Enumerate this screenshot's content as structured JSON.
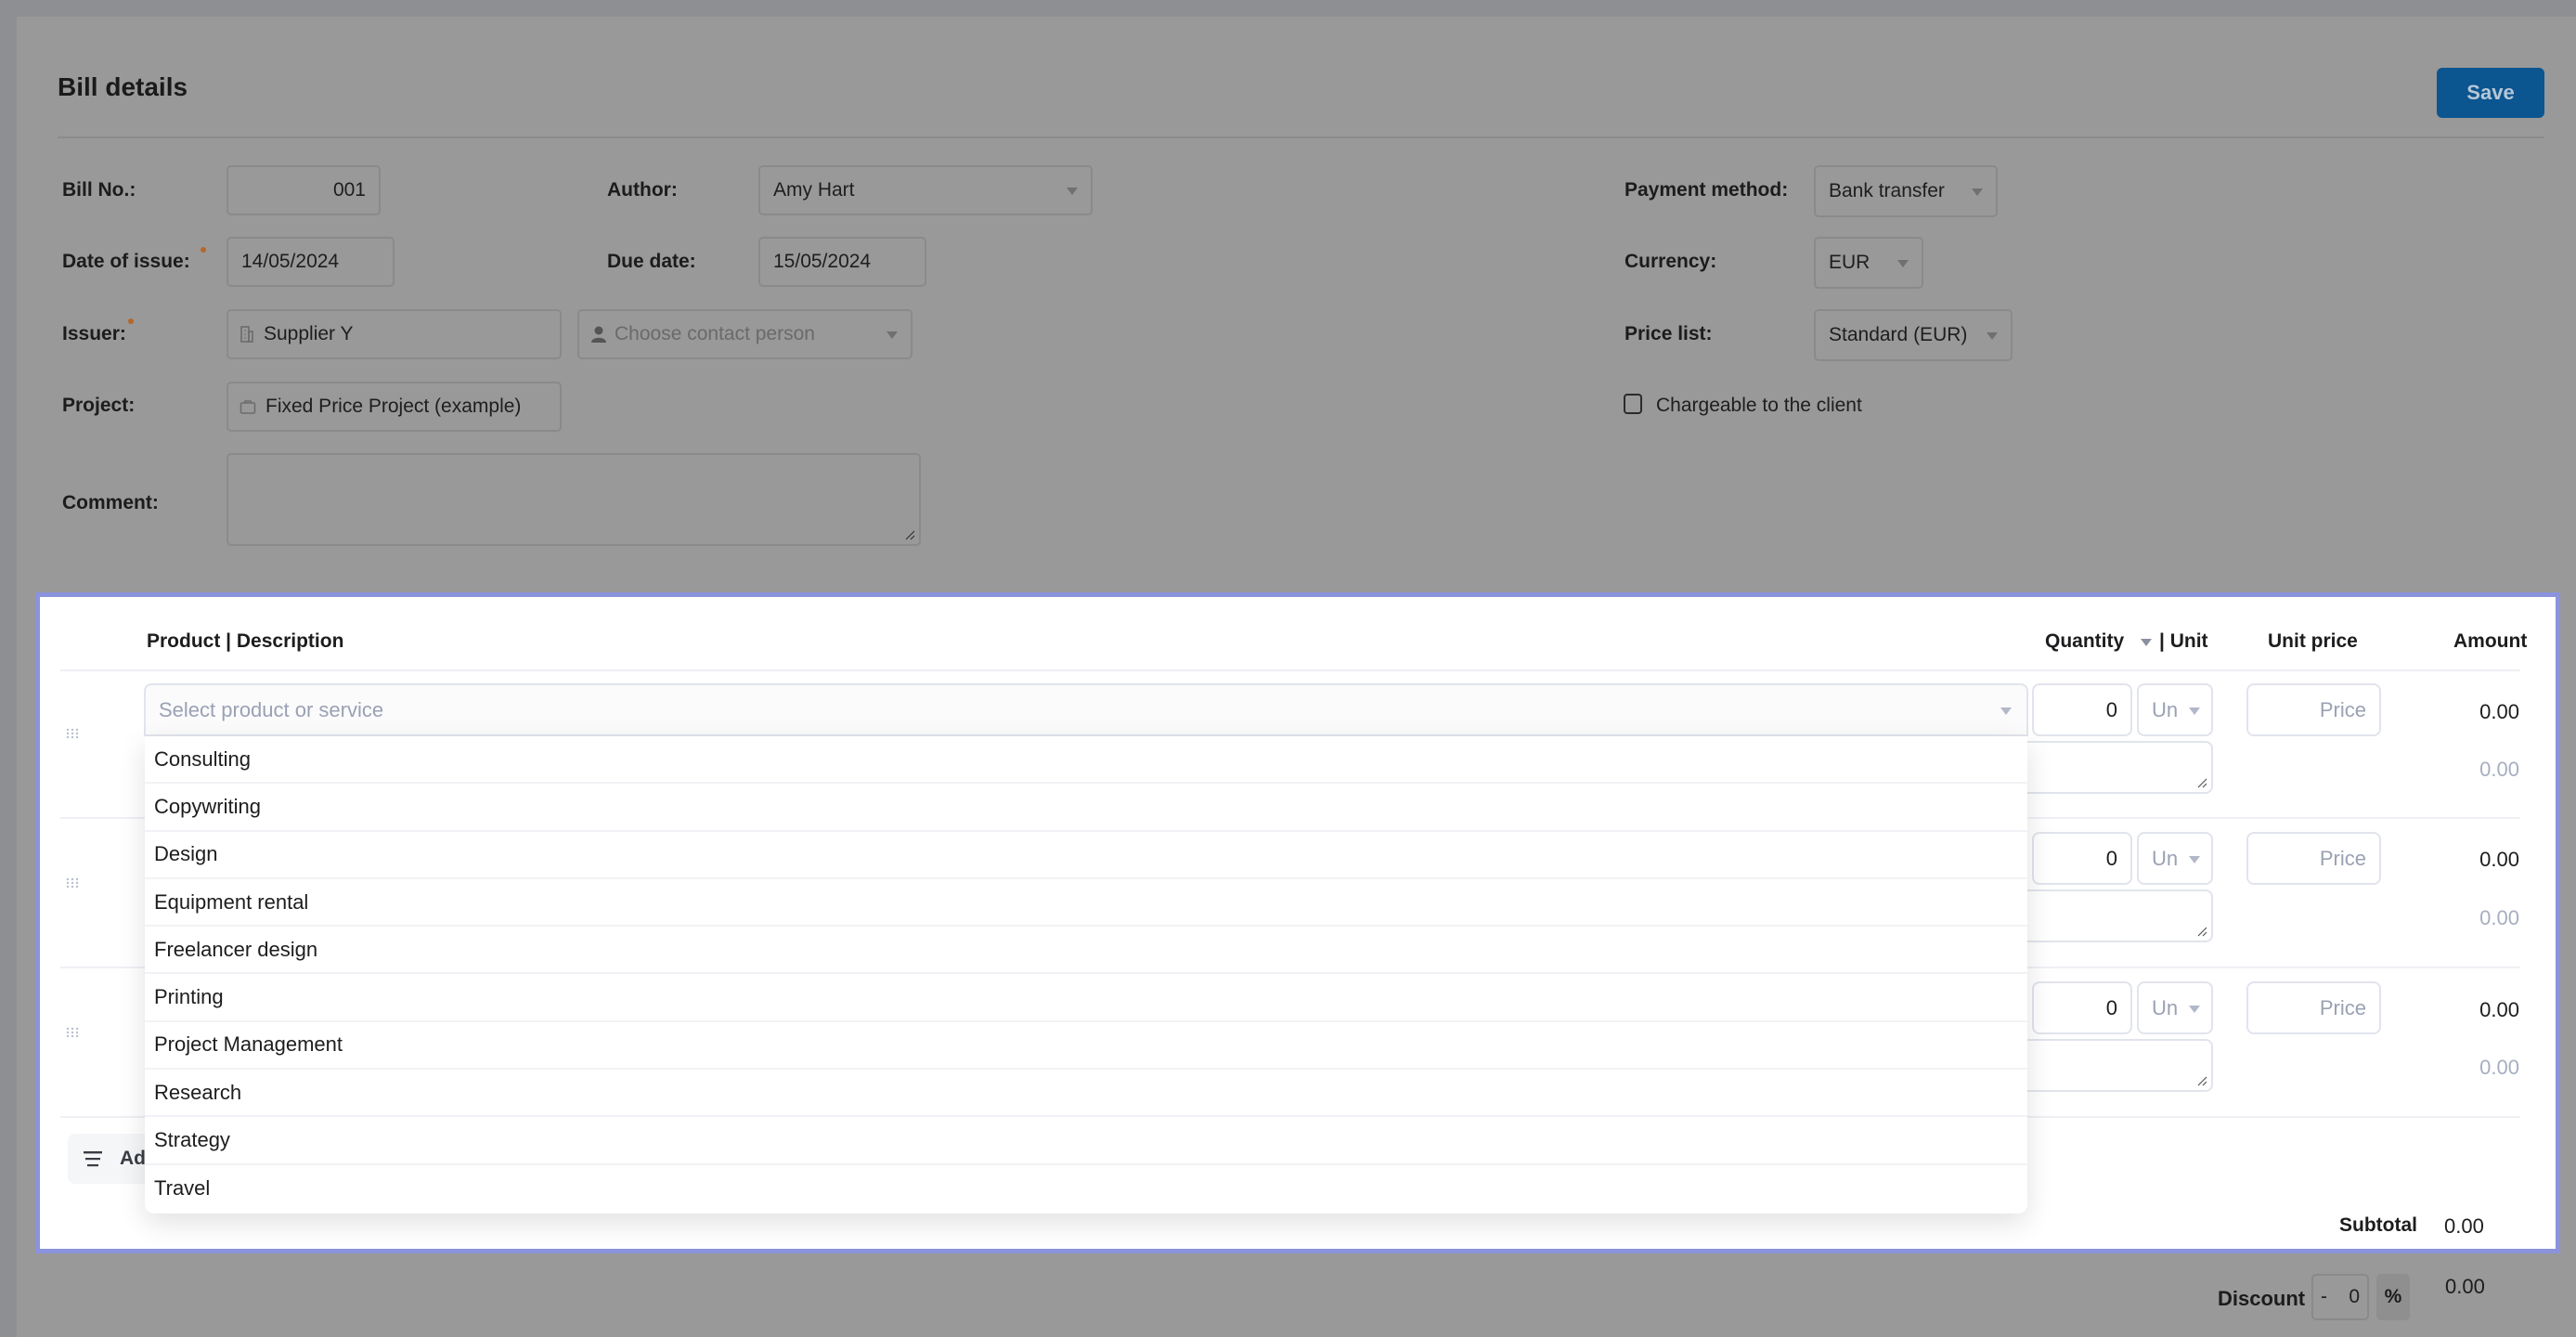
{
  "header": {
    "title": "Bill details",
    "save_label": "Save"
  },
  "form": {
    "bill_no": {
      "label": "Bill No.:",
      "value": "001"
    },
    "author": {
      "label": "Author:",
      "value": "Amy Hart"
    },
    "date_of_issue": {
      "label": "Date of issue:",
      "value": "14/05/2024",
      "required": true
    },
    "due_date": {
      "label": "Due date:",
      "value": "15/05/2024"
    },
    "issuer": {
      "label": "Issuer:",
      "value": "Supplier Y",
      "required": true,
      "icon": "building-icon"
    },
    "contact_person": {
      "placeholder": "Choose contact person",
      "icon": "person-icon"
    },
    "project": {
      "label": "Project:",
      "value": "Fixed Price Project (example)",
      "icon": "briefcase-icon"
    },
    "comment": {
      "label": "Comment:",
      "value": ""
    },
    "payment_method": {
      "label": "Payment method:",
      "value": "Bank transfer"
    },
    "currency": {
      "label": "Currency:",
      "value": "EUR"
    },
    "price_list": {
      "label": "Price list:",
      "value": "Standard (EUR)"
    },
    "chargeable": {
      "label": "Chargeable to the client",
      "checked": false
    }
  },
  "items_table": {
    "columns": {
      "product": "Product | Description",
      "quantity": "Quantity",
      "unit": "| Unit",
      "unit_price": "Unit price",
      "amount": "Amount"
    },
    "product_placeholder": "Select product or service",
    "rows": [
      {
        "quantity": "0",
        "unit": "Un",
        "price_placeholder": "Price",
        "amount": "0.00",
        "sub_amount": "0.00"
      },
      {
        "quantity": "0",
        "unit": "Un",
        "price_placeholder": "Price",
        "amount": "0.00",
        "sub_amount": "0.00"
      },
      {
        "quantity": "0",
        "unit": "Un",
        "price_placeholder": "Price",
        "amount": "0.00",
        "sub_amount": "0.00"
      }
    ],
    "add_button_label": "Add",
    "subtotal_label": "Subtotal",
    "subtotal_value": "0.00"
  },
  "product_dropdown": {
    "options": [
      "Consulting",
      "Copywriting",
      "Design",
      "Equipment rental",
      "Freelancer design",
      "Printing",
      "Project Management",
      "Research",
      "Strategy",
      "Travel"
    ]
  },
  "discount": {
    "label": "Discount",
    "sign": "-",
    "value": "0",
    "unit": "%",
    "amount": "0.00"
  },
  "colors": {
    "save_button": "#0b5590",
    "highlight_border": "#8b93dc",
    "required_dot": "#b5672a",
    "overlay": "#999999"
  }
}
